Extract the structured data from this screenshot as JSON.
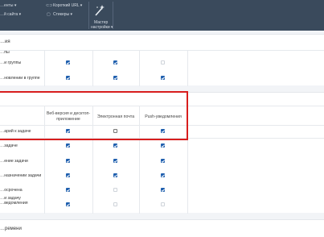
{
  "toolbar": {
    "items": [
      {
        "label": "…енты ▾"
      },
      {
        "label": "…й сайта ▾"
      },
      {
        "label": "Короткий URL ▾",
        "icon": "link-icon"
      },
      {
        "label": "Стикеры ▾",
        "icon": "sticker-icon"
      }
    ],
    "wizard_label_line1": "Мастер",
    "wizard_label_line2": "настройки ▾"
  },
  "section_top": {
    "title": "…ия",
    "rows": [
      {
        "label": "…пы",
        "cells": [
          null,
          null,
          null
        ]
      },
      {
        "label": "…и группы",
        "cells": [
          "on",
          "on",
          "dis"
        ]
      },
      {
        "label": "…новлении в группе",
        "cells": [
          "on",
          "on",
          "on"
        ]
      }
    ]
  },
  "section_tasks": {
    "columns": [
      "Веб-версия и десктоп-приложение",
      "Электронная почта",
      "Push-уведомления"
    ],
    "rows": [
      {
        "label": "…арий к задаче",
        "cells": [
          "on",
          "off",
          "on"
        ]
      },
      {
        "label": "…задаче",
        "cells": [
          "on",
          "on",
          "on"
        ]
      },
      {
        "label": "…ение задачи",
        "cells": [
          "on",
          "on",
          "on"
        ]
      },
      {
        "label": "…назначении задачи",
        "cells": [
          "on",
          "on",
          "on"
        ]
      },
      {
        "label": "…осрочена",
        "cells": [
          "on",
          "dis",
          "on"
        ]
      },
      {
        "label": "…и задачу\n…ведомления",
        "cells": [
          "on",
          "dis",
          "dis"
        ]
      }
    ]
  },
  "section_bottom": {
    "title": "…ремени"
  }
}
